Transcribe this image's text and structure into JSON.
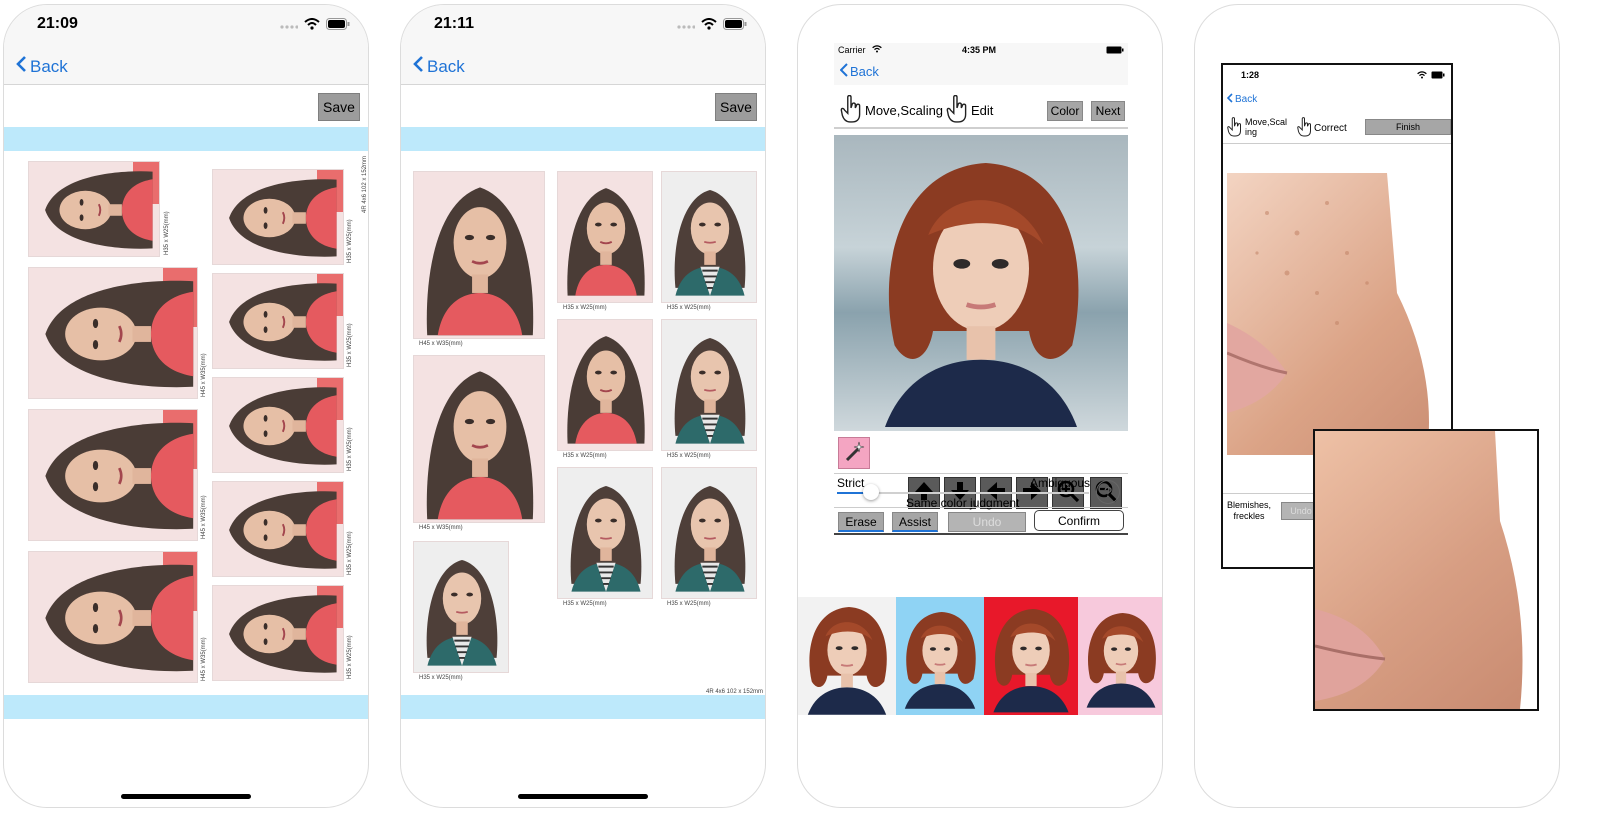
{
  "screen1": {
    "time": "21:09",
    "back_label": "Back",
    "save_label": "Save",
    "sheet_label": "4R 4x6 102 x 152mm",
    "labels": {
      "h35": "H35 x W25(mm)",
      "h45": "H45 x W35(mm)"
    }
  },
  "screen2": {
    "time": "21:11",
    "back_label": "Back",
    "save_label": "Save",
    "sheet_label": "4R 4x6 102 x 152mm",
    "labels": {
      "h45": "H45 x W35(mm)",
      "h35": "H35 x W25(mm)"
    }
  },
  "screen3": {
    "carrier": "Carrier",
    "time": "4:35 PM",
    "back_label": "Back",
    "move_label": "Move,Scaling",
    "edit_label": "Edit",
    "color_label": "Color",
    "next_label": "Next",
    "strict_label": "Strict",
    "ambiguous_label": "Ambiguous",
    "same_color_label": "Same color judgment",
    "help_label": "?",
    "erase_label": "Erase",
    "assist_label": "Assist",
    "undo_label": "Undo",
    "confirm_label": "Confirm",
    "thumb_colors": [
      "#f2f2f2",
      "#8fd3f4",
      "#e8182a",
      "#f7c9dc"
    ]
  },
  "screen4": {
    "time": "1:28",
    "back_label": "Back",
    "move_label": "Move,Scal\ning",
    "correct_label": "Correct",
    "finish_label": "Finish",
    "blemish_label": "Blemishes,\nfreckles",
    "undo_label": "Undo"
  },
  "colors": {
    "accent": "#1f73d6",
    "strip": "#bde9fb",
    "button_gray": "#a6a6a6"
  }
}
